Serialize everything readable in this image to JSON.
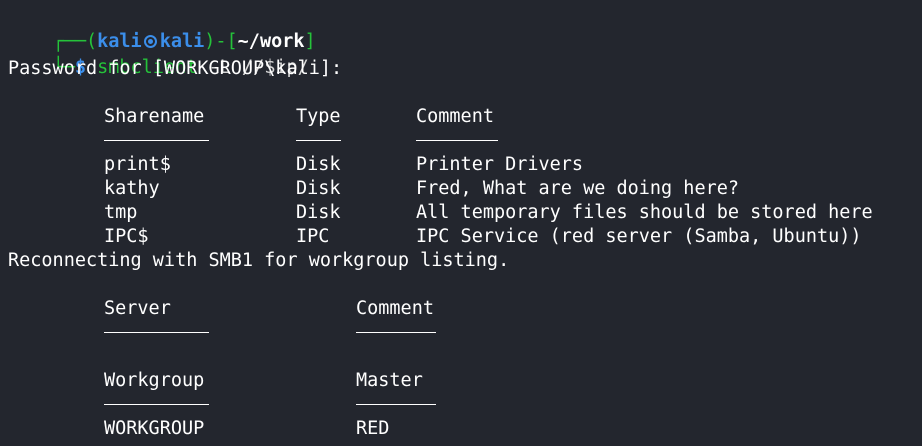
{
  "prompt": {
    "open": "┌──(",
    "user": "kali",
    "host": "kali",
    "close_dir_open": ")-[",
    "dir": "~/work",
    "close": "]",
    "second_line_prefix": "└─",
    "dollar": "$",
    "command": "smbclient",
    "args": " -L //$ip/"
  },
  "output": {
    "password_line": "Password for [WORKGROUP\\kali]:",
    "shares_header": [
      "Sharename",
      "Type",
      "Comment"
    ],
    "shares_underline": [
      "---------",
      "----",
      "-------"
    ],
    "shares": [
      {
        "name": "print$",
        "type": "Disk",
        "comment": "Printer Drivers"
      },
      {
        "name": "kathy",
        "type": "Disk",
        "comment": "Fred, What are we doing here?"
      },
      {
        "name": "tmp",
        "type": "Disk",
        "comment": "All temporary files should be stored here"
      },
      {
        "name": "IPC$",
        "type": "IPC",
        "comment": "IPC Service (red server (Samba, Ubuntu))"
      }
    ],
    "reconnect_line": "Reconnecting with SMB1 for workgroup listing.",
    "server_header": [
      "Server",
      "Comment"
    ],
    "workgroup_header": [
      "Workgroup",
      "Master"
    ],
    "workgroup_row": {
      "workgroup": "WORKGROUP",
      "master": "RED"
    }
  },
  "colors": {
    "background": "#23262e",
    "prompt_blue": "#3b8eea",
    "prompt_green": "#25c23a",
    "text": "#ffffff"
  }
}
